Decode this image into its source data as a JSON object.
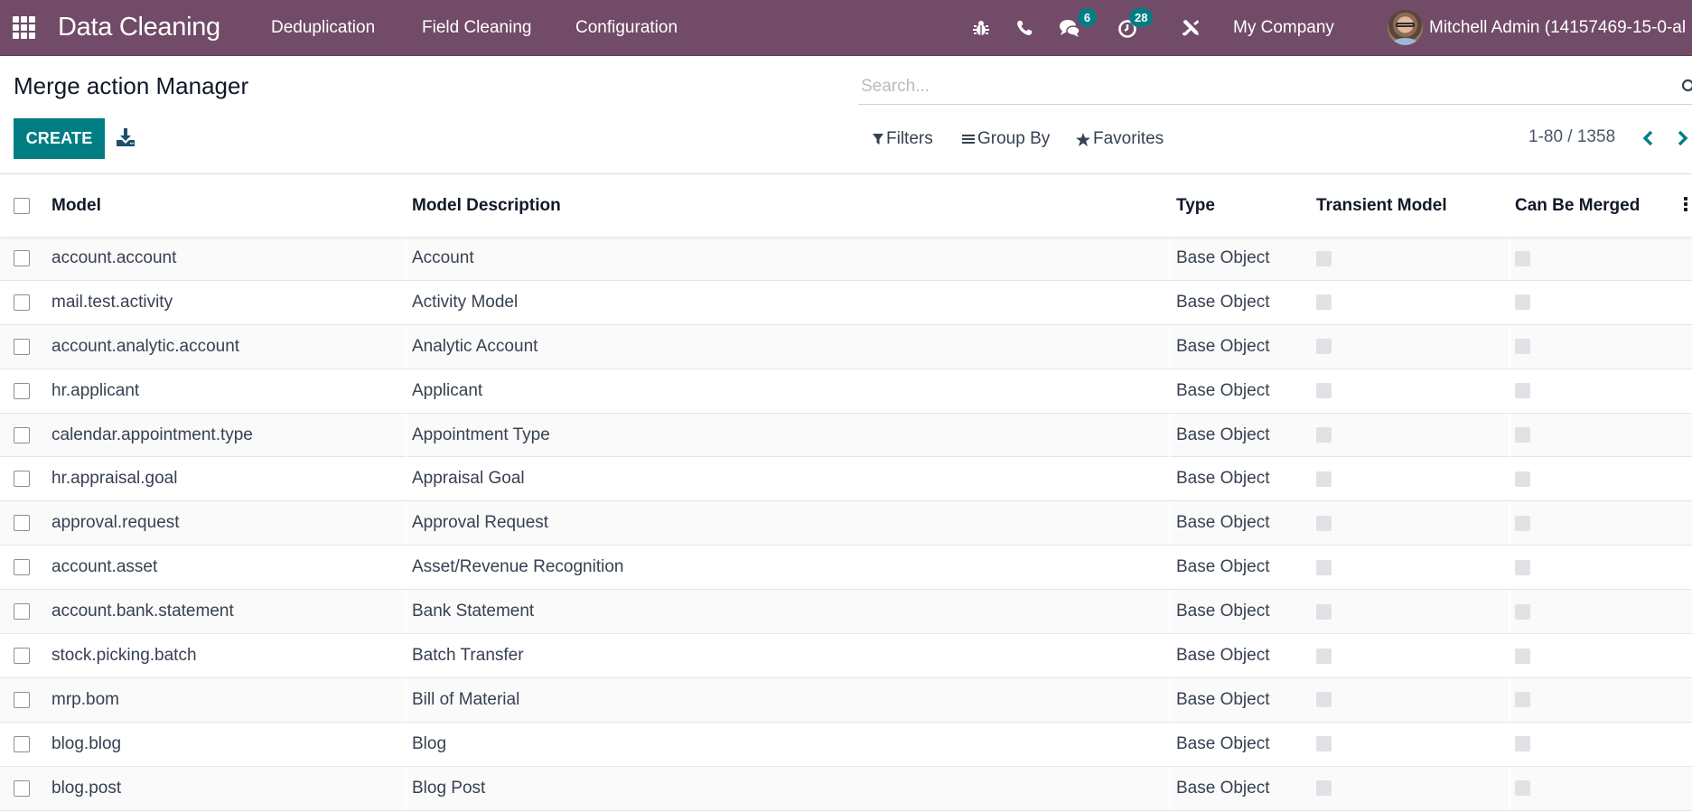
{
  "navbar": {
    "app_title": "Data Cleaning",
    "menu": [
      {
        "label": "Deduplication"
      },
      {
        "label": "Field Cleaning"
      },
      {
        "label": "Configuration"
      }
    ],
    "systray": {
      "icons": [
        "bug-icon",
        "phone-icon",
        "chat-icon",
        "activity-clock-icon",
        "tools-icon"
      ],
      "messages_badge": "6",
      "activities_badge": "28",
      "company": "My Company",
      "user_name": "Mitchell Admin (14157469-15-0-al"
    },
    "colors": {
      "navbar_bg": "#714b67",
      "badge_bg": "#017e84"
    }
  },
  "control_panel": {
    "title": "Merge action Manager",
    "search_placeholder": "Search...",
    "create_label": "CREATE",
    "filters_label": "Filters",
    "group_by_label": "Group By",
    "favorites_label": "Favorites",
    "pager_value": "1-80 / 1358",
    "colors": {
      "primary": "#017e84"
    }
  },
  "table": {
    "columns": [
      "Model",
      "Model Description",
      "Type",
      "Transient Model",
      "Can Be Merged"
    ],
    "rows": [
      {
        "model": "account.account",
        "description": "Account",
        "type": "Base Object",
        "transient": false,
        "can_merge": false
      },
      {
        "model": "mail.test.activity",
        "description": "Activity Model",
        "type": "Base Object",
        "transient": false,
        "can_merge": false
      },
      {
        "model": "account.analytic.account",
        "description": "Analytic Account",
        "type": "Base Object",
        "transient": false,
        "can_merge": false
      },
      {
        "model": "hr.applicant",
        "description": "Applicant",
        "type": "Base Object",
        "transient": false,
        "can_merge": false
      },
      {
        "model": "calendar.appointment.type",
        "description": "Appointment Type",
        "type": "Base Object",
        "transient": false,
        "can_merge": false
      },
      {
        "model": "hr.appraisal.goal",
        "description": "Appraisal Goal",
        "type": "Base Object",
        "transient": false,
        "can_merge": false
      },
      {
        "model": "approval.request",
        "description": "Approval Request",
        "type": "Base Object",
        "transient": false,
        "can_merge": false
      },
      {
        "model": "account.asset",
        "description": "Asset/Revenue Recognition",
        "type": "Base Object",
        "transient": false,
        "can_merge": false
      },
      {
        "model": "account.bank.statement",
        "description": "Bank Statement",
        "type": "Base Object",
        "transient": false,
        "can_merge": false
      },
      {
        "model": "stock.picking.batch",
        "description": "Batch Transfer",
        "type": "Base Object",
        "transient": false,
        "can_merge": false
      },
      {
        "model": "mrp.bom",
        "description": "Bill of Material",
        "type": "Base Object",
        "transient": false,
        "can_merge": false
      },
      {
        "model": "blog.blog",
        "description": "Blog",
        "type": "Base Object",
        "transient": false,
        "can_merge": false
      },
      {
        "model": "blog.post",
        "description": "Blog Post",
        "type": "Base Object",
        "transient": false,
        "can_merge": false
      }
    ]
  }
}
